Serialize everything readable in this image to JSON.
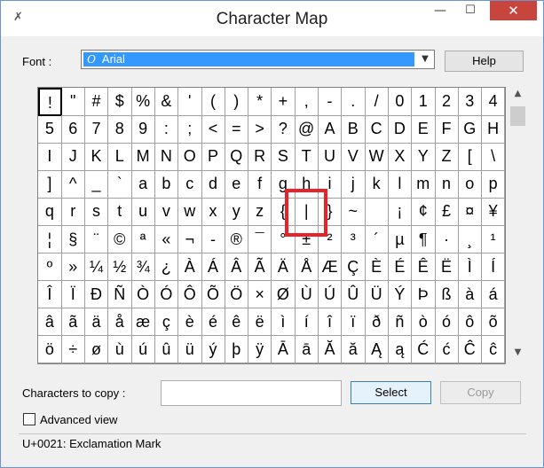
{
  "window": {
    "title": "Character Map"
  },
  "title_buttons": {
    "minimize": "—",
    "maximize": "☐",
    "close": "✕"
  },
  "font": {
    "label": "Font :",
    "selected": "Arial",
    "icon_glyph": "O"
  },
  "help_label": "Help",
  "grid": {
    "rows": [
      [
        "!",
        "\"",
        "#",
        "$",
        "%",
        "&",
        "'",
        "(",
        ")",
        "*",
        "+",
        ",",
        "-",
        ".",
        "/",
        "0",
        "1",
        "2",
        "3",
        "4"
      ],
      [
        "5",
        "6",
        "7",
        "8",
        "9",
        ":",
        ";",
        "<",
        "=",
        ">",
        "?",
        "@",
        "A",
        "B",
        "C",
        "D",
        "E",
        "F",
        "G",
        "H"
      ],
      [
        "I",
        "J",
        "K",
        "L",
        "M",
        "N",
        "O",
        "P",
        "Q",
        "R",
        "S",
        "T",
        "U",
        "V",
        "W",
        "X",
        "Y",
        "Z",
        "[",
        "\\"
      ],
      [
        "]",
        "^",
        "_",
        "`",
        "a",
        "b",
        "c",
        "d",
        "e",
        "f",
        "g",
        "h",
        "i",
        "j",
        "k",
        "l",
        "m",
        "n",
        "o",
        "p"
      ],
      [
        "q",
        "r",
        "s",
        "t",
        "u",
        "v",
        "w",
        "x",
        "y",
        "z",
        "{",
        "|",
        "}",
        "~",
        "",
        "¡",
        "¢",
        "£",
        "¤",
        "¥"
      ],
      [
        "¦",
        "§",
        "¨",
        "©",
        "ª",
        "«",
        "¬",
        "-",
        "®",
        "¯",
        "°",
        "±",
        "²",
        "³",
        "´",
        "µ",
        "¶",
        "·",
        "¸",
        "¹"
      ],
      [
        "º",
        "»",
        "¼",
        "½",
        "¾",
        "¿",
        "À",
        "Á",
        "Â",
        "Ã",
        "Ä",
        "Å",
        "Æ",
        "Ç",
        "È",
        "É",
        "Ê",
        "Ë",
        "Ì",
        "Í"
      ],
      [
        "Î",
        "Ï",
        "Ð",
        "Ñ",
        "Ò",
        "Ó",
        "Ô",
        "Õ",
        "Ö",
        "×",
        "Ø",
        "Ù",
        "Ú",
        "Û",
        "Ü",
        "Ý",
        "Þ",
        "ß",
        "à",
        "á"
      ],
      [
        "â",
        "ã",
        "ä",
        "å",
        "æ",
        "ç",
        "è",
        "é",
        "ê",
        "ë",
        "ì",
        "í",
        "î",
        "ï",
        "ð",
        "ñ",
        "ò",
        "ó",
        "ô",
        "õ"
      ],
      [
        "ö",
        "÷",
        "ø",
        "ù",
        "ú",
        "û",
        "ü",
        "ý",
        "þ",
        "ÿ",
        "Ā",
        "ā",
        "Ă",
        "ă",
        "Ą",
        "ą",
        "Ć",
        "ć",
        "Ĉ",
        "ĉ"
      ]
    ],
    "selected_index": 0,
    "highlight": {
      "row": 4,
      "col": 11
    }
  },
  "scrollbar": {
    "up": "▲",
    "down": "▼"
  },
  "copy": {
    "label": "Characters to copy :",
    "value": ""
  },
  "select_label": "Select",
  "copy_label": "Copy",
  "advanced": {
    "label": "Advanced view",
    "checked": false
  },
  "status": "U+0021: Exclamation Mark"
}
